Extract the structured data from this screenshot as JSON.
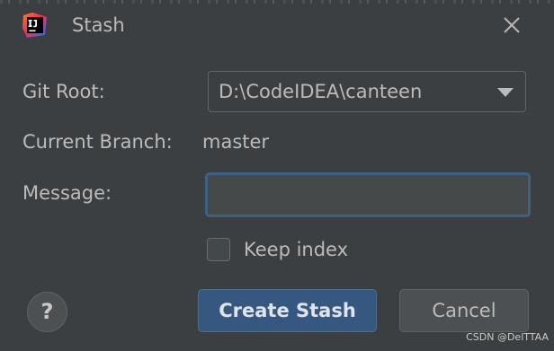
{
  "window": {
    "title": "Stash",
    "app_icon": "intellij-idea-icon",
    "close_icon": "close-icon"
  },
  "form": {
    "git_root_label": "Git Root:",
    "git_root_value": "D:\\CodeIDEA\\canteen",
    "current_branch_label": "Current Branch:",
    "current_branch_value": "master",
    "message_label": "Message:",
    "message_value": "",
    "keep_index_label": "Keep index",
    "keep_index_checked": false
  },
  "buttons": {
    "help_label": "?",
    "create_label": "Create Stash",
    "cancel_label": "Cancel"
  },
  "watermark": "CSDN @DelTTAA",
  "colors": {
    "background": "#3c3f41",
    "text": "#bbbbbb",
    "primary_button": "#365880",
    "focus_border": "#3d6185"
  }
}
